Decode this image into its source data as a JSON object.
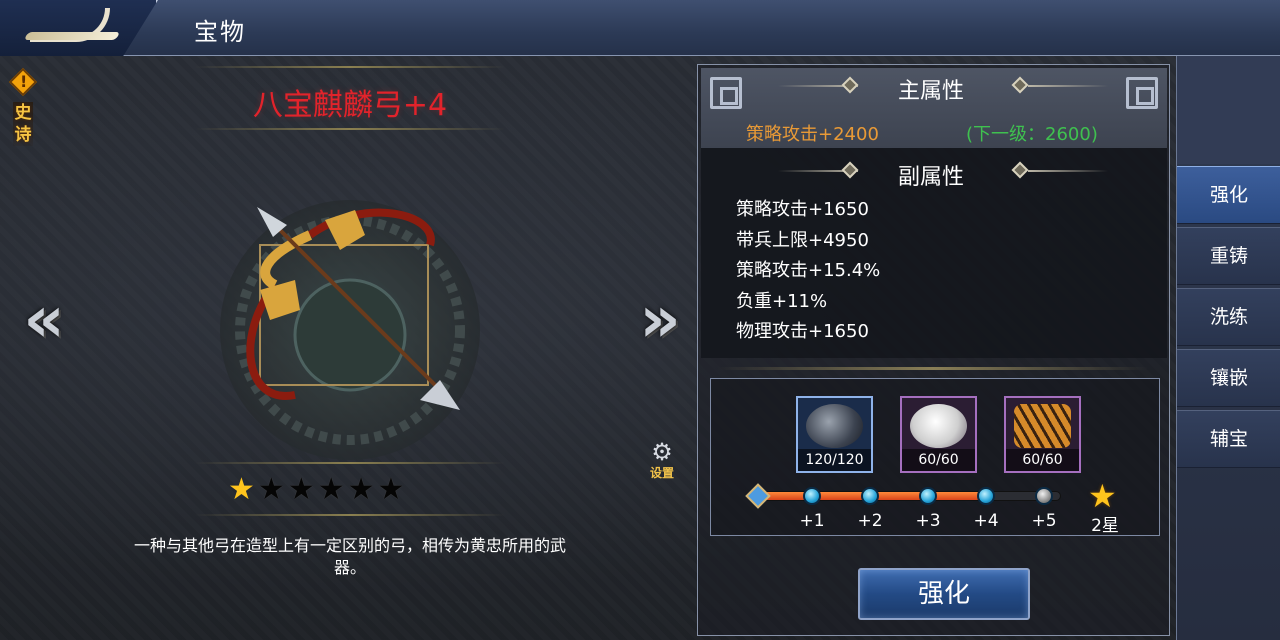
{
  "header": {
    "title": "宝物"
  },
  "item": {
    "name": "八宝麒麟弓+4",
    "rarity": "史诗",
    "stars_filled": 1,
    "stars_total": 6,
    "description": "一种与其他弓在造型上有一定区别的弓，相传为黄忠所用的武器。"
  },
  "settings": {
    "label": "设置"
  },
  "main_attr": {
    "title": "主属性",
    "value": "策略攻击+2400",
    "next": "(下一级：2600)"
  },
  "sub_attr": {
    "title": "副属性",
    "items": [
      "策略攻击+1650",
      "带兵上限+4950",
      "策略攻击+15.4%",
      "负重+11%",
      "物理攻击+1650"
    ]
  },
  "materials": [
    {
      "name": "ore",
      "count": "120/120",
      "frame": "blue"
    },
    {
      "name": "silk",
      "count": "60/60",
      "frame": "purple"
    },
    {
      "name": "tiger-pelt",
      "count": "60/60",
      "frame": "purple"
    }
  ],
  "progress": {
    "labels": [
      "+1",
      "+2",
      "+3",
      "+4",
      "+5",
      "2星"
    ],
    "completed": 4,
    "total": 5
  },
  "buttons": {
    "enhance": "强化"
  },
  "tabs": [
    {
      "label": "强化",
      "active": true
    },
    {
      "label": "重铸",
      "active": false
    },
    {
      "label": "洗练",
      "active": false
    },
    {
      "label": "镶嵌",
      "active": false
    },
    {
      "label": "辅宝",
      "active": false
    }
  ],
  "colors": {
    "name_red": "#e2232b",
    "main_attr_orange": "#e99a36",
    "next_green": "#3fc14f",
    "star_gold": "#ffc41d"
  }
}
